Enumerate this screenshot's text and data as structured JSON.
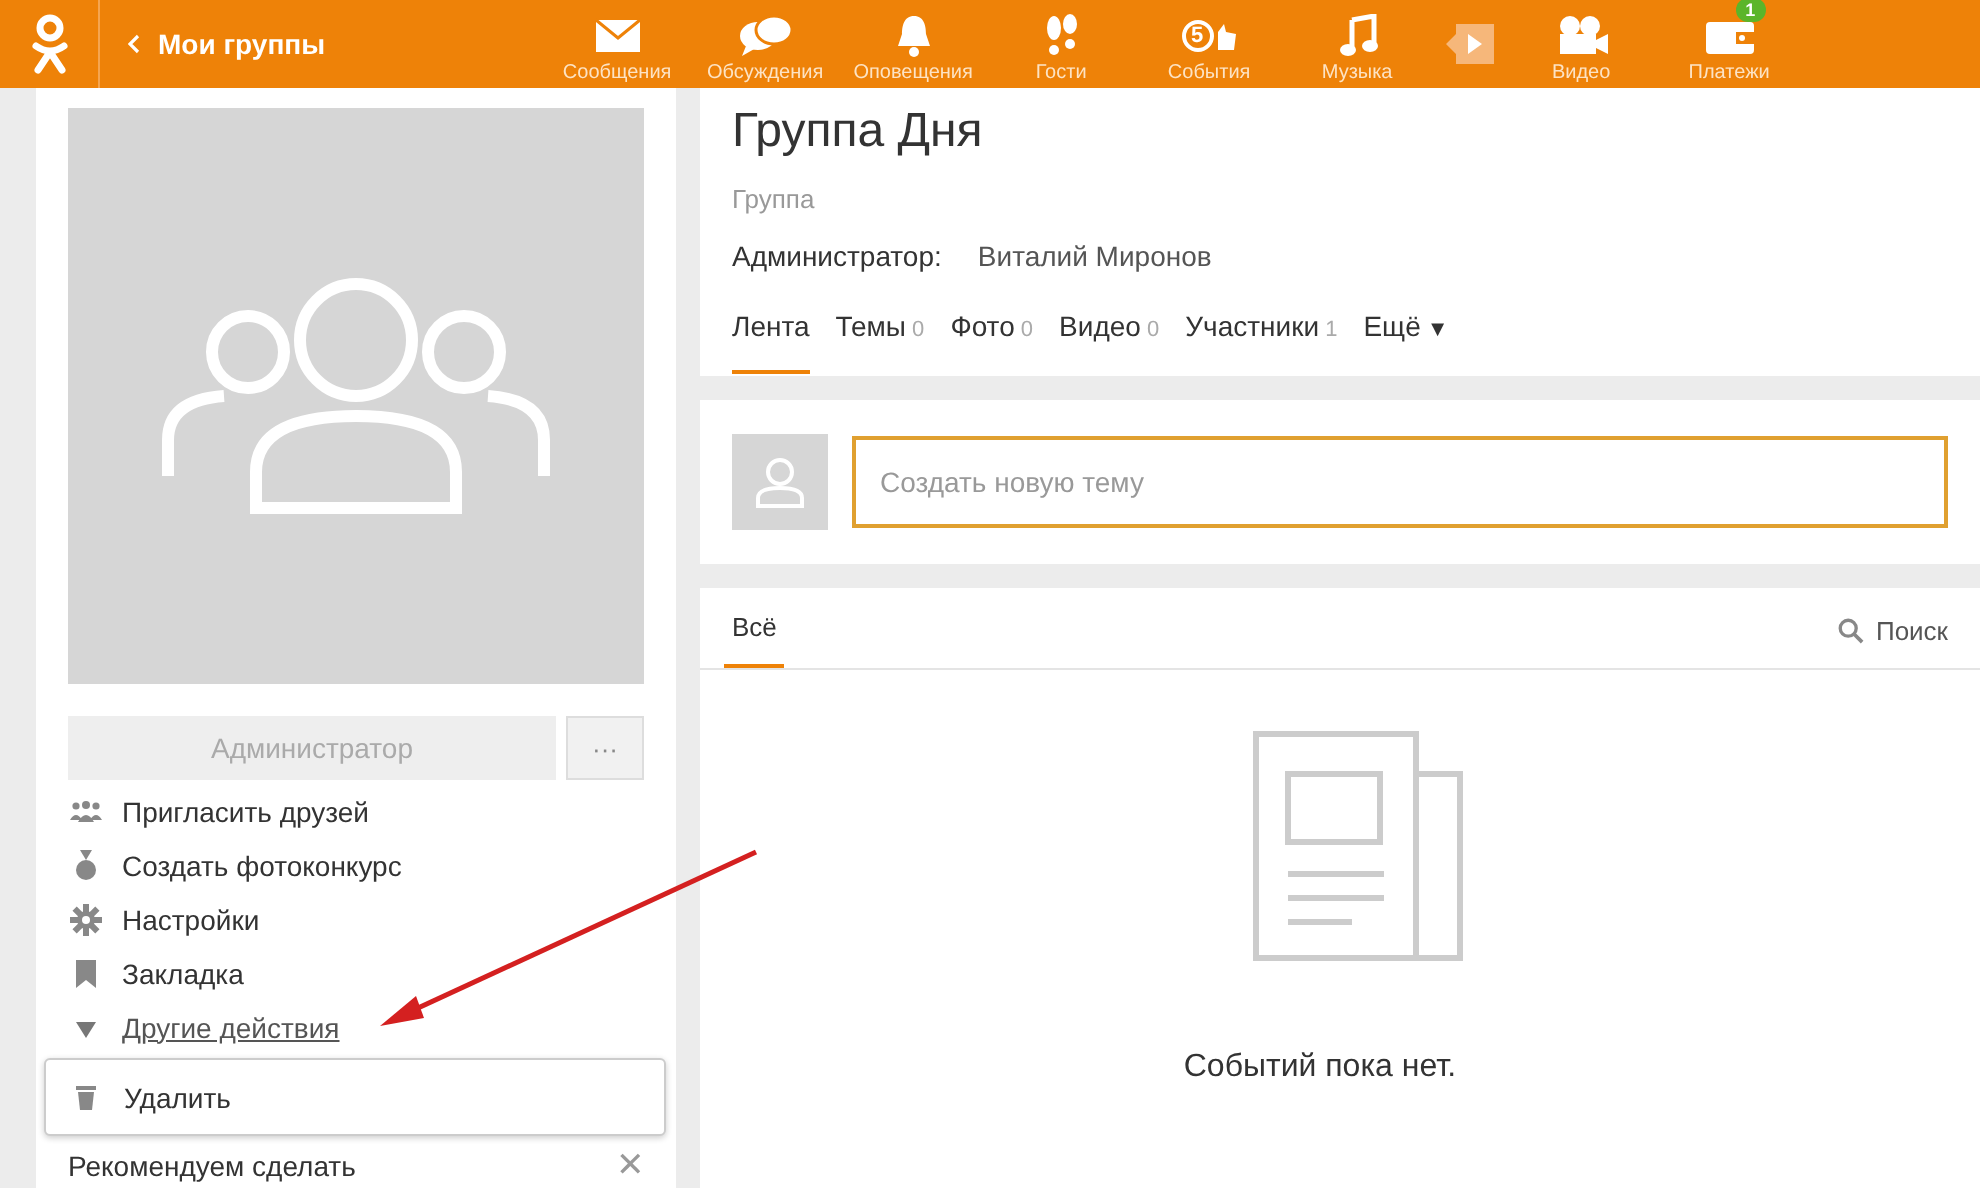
{
  "header": {
    "back_link": "Мои группы",
    "nav": [
      {
        "kind": "tab",
        "label": "Сообщения"
      },
      {
        "kind": "tab",
        "label": "Обсуждения"
      },
      {
        "kind": "tab",
        "label": "Оповещения"
      },
      {
        "kind": "tab",
        "label": "Гости"
      },
      {
        "kind": "tab",
        "label": "События",
        "badge_icon": "5"
      },
      {
        "kind": "tab",
        "label": "Музыка"
      },
      {
        "kind": "player"
      },
      {
        "kind": "tab",
        "label": "Видео"
      },
      {
        "kind": "tab",
        "label": "Платежи",
        "badge": "1"
      }
    ]
  },
  "sidebar": {
    "role_button": "Администратор",
    "more_button": "···",
    "actions": [
      {
        "kind": "action",
        "label": "Пригласить друзей"
      },
      {
        "kind": "action",
        "label": "Создать фотоконкурс"
      },
      {
        "kind": "action",
        "label": "Настройки"
      },
      {
        "kind": "action",
        "label": "Закладка"
      },
      {
        "kind": "toggle",
        "label": "Другие действия",
        "expanded": true
      }
    ],
    "dropdown": [
      {
        "label": "Удалить"
      }
    ],
    "recommend": {
      "title": "Рекомендуем сделать",
      "close": "✕"
    }
  },
  "group": {
    "title": "Группа Дня",
    "type": "Группа",
    "admin_label": "Администратор:",
    "admin_name": "Виталий Миронов",
    "tabs": [
      {
        "label": "Лента",
        "selected": true
      },
      {
        "label": "Темы",
        "count": "0",
        "selected": false
      },
      {
        "label": "Фото",
        "count": "0",
        "selected": false
      },
      {
        "label": "Видео",
        "count": "0",
        "selected": false
      },
      {
        "label": "Участники",
        "count": "1",
        "selected": false
      },
      {
        "label": "Ещё",
        "caret": "▼",
        "selected": false
      }
    ]
  },
  "composer": {
    "placeholder": "Создать новую тему"
  },
  "feed": {
    "filters": [
      {
        "label": "Всё",
        "selected": true
      }
    ],
    "search": "Поиск",
    "empty": "Событий пока нет."
  }
}
